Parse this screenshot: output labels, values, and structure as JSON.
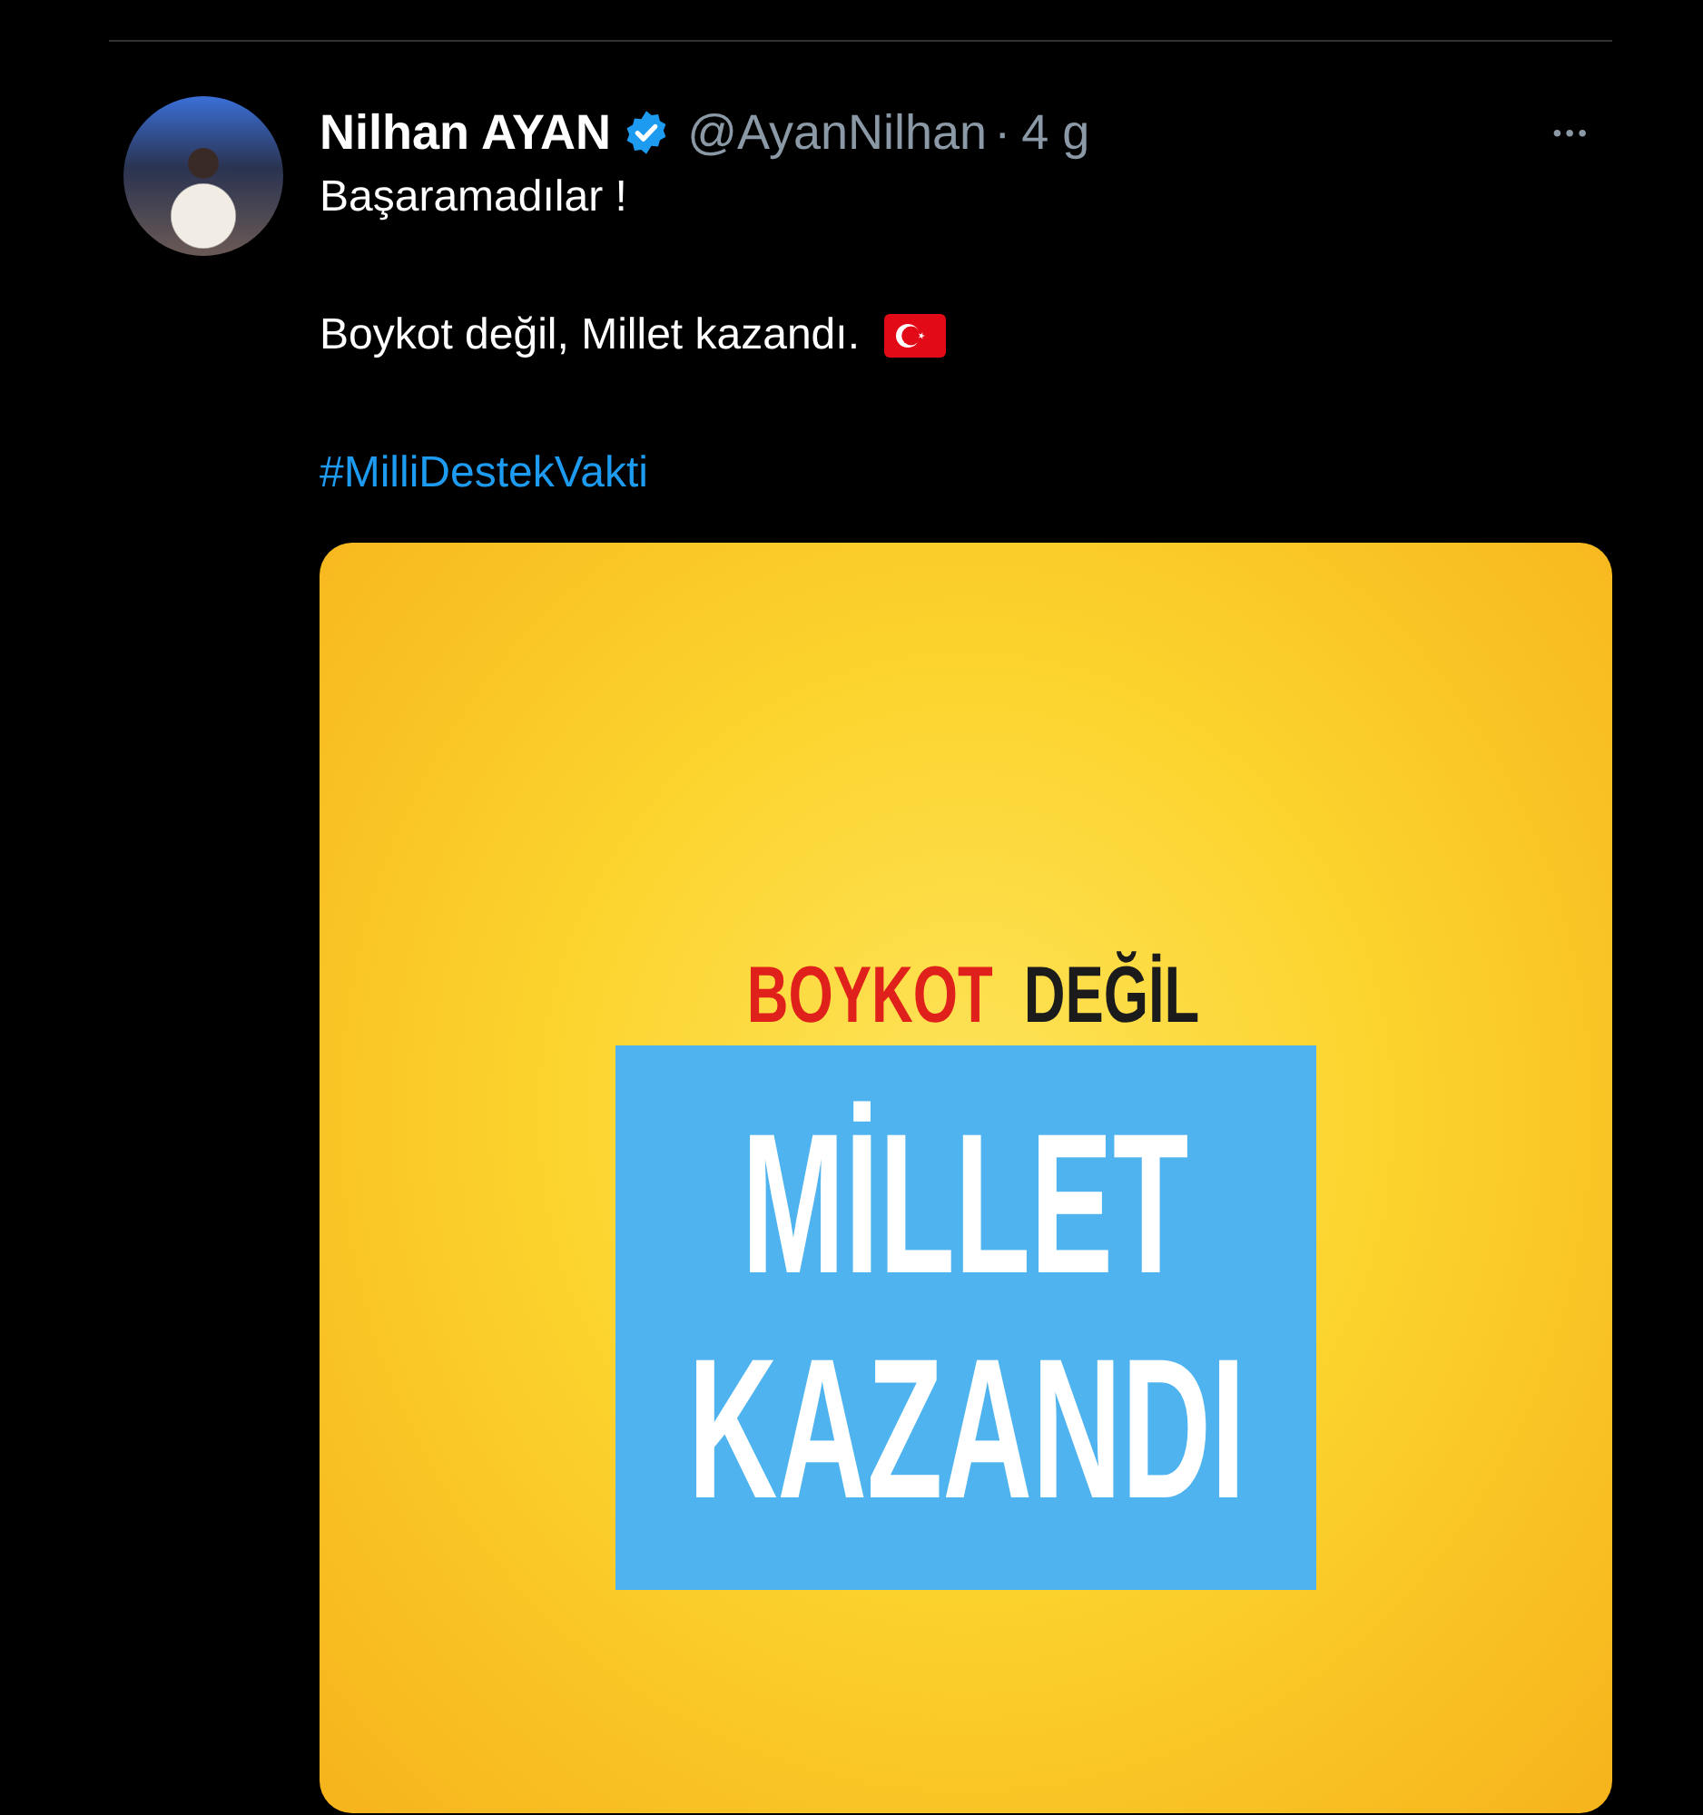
{
  "tweet": {
    "author": {
      "name": "Nilhan AYAN",
      "verified": true,
      "handle": "@AyanNilhan",
      "separator": "·",
      "time": "4 g"
    },
    "more": "•••",
    "paragraphs": [
      {
        "text": "Başaramadılar !",
        "kind": "plain"
      },
      {
        "text": "Boykot değil, Millet kazandı.",
        "kind": "flag"
      },
      {
        "text": "#MilliDestekVakti",
        "kind": "hashtag"
      }
    ],
    "media": {
      "headline": [
        {
          "text": "BOYKOT",
          "kind": "accent"
        },
        {
          "text": "DEĞİL",
          "kind": "plain"
        }
      ],
      "box_lines": [
        "MİLLET",
        "KAZANDI"
      ]
    }
  }
}
